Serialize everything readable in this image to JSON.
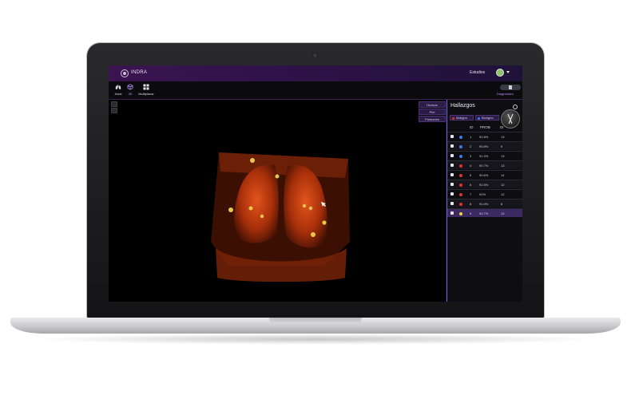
{
  "app": {
    "logo_text": "INDRA"
  },
  "header": {
    "studies_link": "Estudios"
  },
  "toolbar": {
    "tools": [
      {
        "label": "Axial",
        "icon": "lungs-icon"
      },
      {
        "label": "3D",
        "icon": "cube-3d-icon",
        "active": true
      },
      {
        "label": "Multiplanar",
        "icon": "grid-icon"
      }
    ],
    "diagnosis_label": "Diagnóstico"
  },
  "viewport": {
    "volume_buttons": [
      "Huesos",
      "Piel",
      "Pulmones"
    ]
  },
  "panel": {
    "title": "Hallazgos",
    "filters": [
      {
        "label": "Maligno",
        "color": "#e0342a"
      },
      {
        "label": "Benigno",
        "color": "#3d7bf2"
      }
    ],
    "columns": [
      "ID",
      "PROB",
      "DI"
    ],
    "rows": [
      {
        "id": "1",
        "prob": "92.8%",
        "di": "13",
        "severity": "benign"
      },
      {
        "id": "2",
        "prob": "90.8%",
        "di": "9",
        "severity": "benign"
      },
      {
        "id": "3",
        "prob": "91.3%",
        "di": "13",
        "severity": "benign"
      },
      {
        "id": "4",
        "prob": "90.7%",
        "di": "13",
        "severity": "malignant"
      },
      {
        "id": "5",
        "prob": "90.6%",
        "di": "14",
        "severity": "malignant"
      },
      {
        "id": "6",
        "prob": "92.5%",
        "di": "12",
        "severity": "malignant"
      },
      {
        "id": "7",
        "prob": "92%",
        "di": "12",
        "severity": "malignant"
      },
      {
        "id": "8",
        "prob": "91.9%",
        "di": "8",
        "severity": "malignant"
      },
      {
        "id": "9",
        "prob": "90.7%",
        "di": "13",
        "severity": "selected"
      }
    ]
  },
  "colors": {
    "accent": "#8a5cff",
    "topbar": "#3b1450",
    "malignant": "#e0342a",
    "benign": "#3d7bf2",
    "selected_marker": "#f2d23a",
    "render_tissue": "#c8360c",
    "nodule": "#e8c84a"
  }
}
